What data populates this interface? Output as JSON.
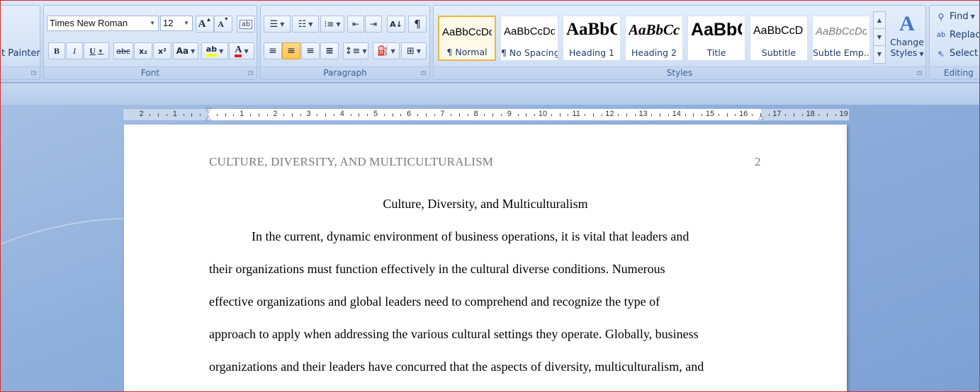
{
  "clipboard": {
    "format_painter_label": "t Painter"
  },
  "font": {
    "group_label": "Font",
    "font_name": "Times New Roman",
    "font_size": "12",
    "grow_label": "A",
    "shrink_label": "A",
    "bold_label": "B",
    "italic_label": "I",
    "underline_label": "U",
    "strike_label": "abc",
    "subscript_label": "x₂",
    "superscript_label": "x²",
    "case_label": "Aa",
    "highlight_label": "ab",
    "font_color_label": "A"
  },
  "paragraph": {
    "group_label": "Paragraph",
    "pilcrow": "¶"
  },
  "styles": {
    "group_label": "Styles",
    "items": [
      {
        "sample": "AaBbCcDd",
        "name": "¶ Normal"
      },
      {
        "sample": "AaBbCcDd",
        "name": "¶ No Spacing"
      },
      {
        "sample": "AaBbC",
        "name": "Heading 1"
      },
      {
        "sample": "AaBbCc",
        "name": "Heading 2"
      },
      {
        "sample": "AaBbC",
        "name": "Title"
      },
      {
        "sample": "AaBbCcD",
        "name": "Subtitle"
      },
      {
        "sample": "AaBbCcDd",
        "name": "Subtle Emp..."
      }
    ],
    "change_styles_line1": "Change",
    "change_styles_line2": "Styles"
  },
  "editing": {
    "group_label": "Editing",
    "find_label": "Find",
    "replace_label": "Replace",
    "select_label": "Select"
  },
  "document": {
    "header_text": "CULTURE, DIVERSITY, AND MULTICULTURALISM",
    "page_number": "2",
    "title": "Culture, Diversity, and Multiculturalism",
    "lines": [
      "In the current, dynamic environment of business operations, it is vital that leaders and",
      "their organizations must function effectively in the cultural diverse conditions. Numerous",
      "effective organizations and global leaders need to comprehend and recognize the type of",
      "approach to apply when addressing the various cultural settings they operate. Globally, business",
      "organizations and their leaders have concurred that the aspects of diversity, multiculturalism, and"
    ]
  },
  "ruler": {
    "labels": [
      "2",
      "1",
      "1",
      "2",
      "3",
      "4",
      "5",
      "6",
      "7",
      "8",
      "9",
      "10",
      "11",
      "12",
      "13",
      "14",
      "15",
      "16",
      "17",
      "18",
      "19"
    ]
  },
  "colors": {
    "highlight": "#ffff00",
    "font_color": "#e02020",
    "selected_style": "#f2b445"
  }
}
